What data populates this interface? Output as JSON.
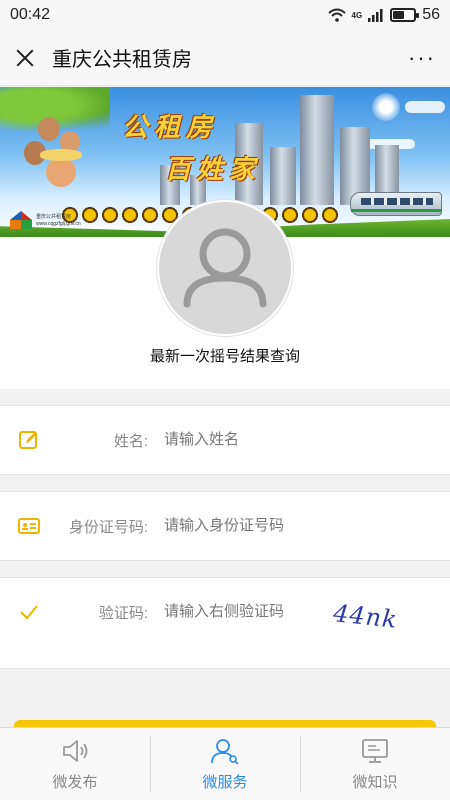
{
  "status_bar": {
    "time": "00:42",
    "network": "4G",
    "battery": "56",
    "battery_level": 0.56
  },
  "header": {
    "title": "重庆公共租赁房",
    "close_icon": "close-icon",
    "more_label": "···"
  },
  "banner": {
    "slogan_line1": "公租房",
    "slogan_line2": "百姓家",
    "logo_text_line1": "重庆公共租赁房",
    "logo_text_line2": "www.cqgzfglj.gov.cn"
  },
  "profile": {
    "caption": "最新一次摇号结果查询"
  },
  "form": {
    "name": {
      "icon": "edit-icon",
      "label": "姓名:",
      "placeholder": "请输入姓名",
      "value": ""
    },
    "id_number": {
      "icon": "id-card-icon",
      "label": "身份证号码:",
      "placeholder": "请输入身份证号码",
      "value": ""
    },
    "captcha": {
      "icon": "check-icon",
      "label": "验证码:",
      "placeholder": "请输入右侧验证码",
      "value": "",
      "image_text": "44nk"
    }
  },
  "tabbar": {
    "tabs": [
      {
        "label": "微发布",
        "icon": "speaker-icon",
        "active": false
      },
      {
        "label": "微服务",
        "icon": "user-service-icon",
        "active": true
      },
      {
        "label": "微知识",
        "icon": "monitor-icon",
        "active": false
      }
    ]
  },
  "colors": {
    "accent_yellow": "#f6c700",
    "active_blue": "#2a8ce8",
    "icon_yellow": "#f0b400"
  }
}
